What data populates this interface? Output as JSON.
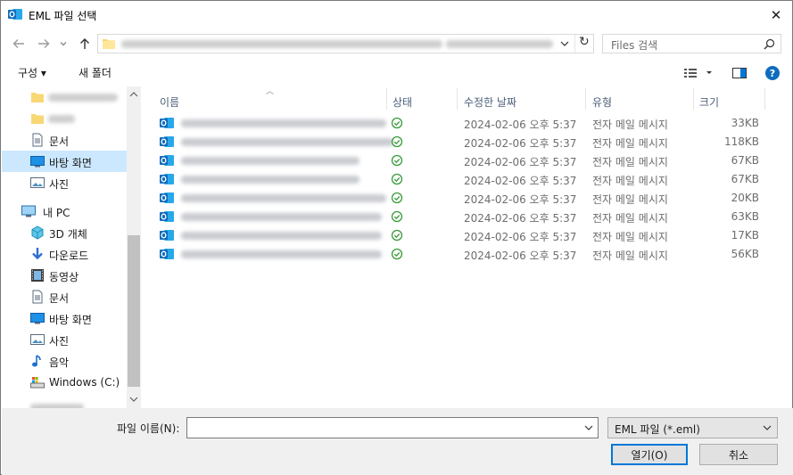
{
  "window": {
    "title": "EML 파일 선택",
    "close_glyph": "✕"
  },
  "address": {
    "refresh_glyph": "↻"
  },
  "search": {
    "placeholder": "Files 검색"
  },
  "toolbar": {
    "organize_label": "구성 ▾",
    "new_folder_label": "새 폴더",
    "help_glyph": "?"
  },
  "sidebar": {
    "items": [
      {
        "label": "문서",
        "icon": "document-icon"
      },
      {
        "label": "바탕 화면",
        "icon": "desktop-icon",
        "selected": true
      },
      {
        "label": "사진",
        "icon": "pictures-icon"
      },
      {
        "label": "내 PC",
        "icon": "pc-icon"
      },
      {
        "label": "3D 개체",
        "icon": "3d-objects-icon"
      },
      {
        "label": "다운로드",
        "icon": "download-icon"
      },
      {
        "label": "동영상",
        "icon": "video-icon"
      },
      {
        "label": "문서",
        "icon": "document-icon"
      },
      {
        "label": "바탕 화면",
        "icon": "desktop-icon"
      },
      {
        "label": "사진",
        "icon": "pictures-icon"
      },
      {
        "label": "음악",
        "icon": "music-icon"
      },
      {
        "label": "Windows (C:)",
        "icon": "drive-icon"
      }
    ]
  },
  "columns": {
    "name": "이름",
    "status": "상태",
    "modified": "수정한 날짜",
    "type": "유형",
    "size": "크기"
  },
  "files": [
    {
      "date": "2024-02-06 오후 5:37",
      "type": "전자 메일 메시지",
      "size": "33KB"
    },
    {
      "date": "2024-02-06 오후 5:37",
      "type": "전자 메일 메시지",
      "size": "118KB"
    },
    {
      "date": "2024-02-06 오후 5:37",
      "type": "전자 메일 메시지",
      "size": "67KB"
    },
    {
      "date": "2024-02-06 오후 5:37",
      "type": "전자 메일 메시지",
      "size": "67KB"
    },
    {
      "date": "2024-02-06 오후 5:37",
      "type": "전자 메일 메시지",
      "size": "20KB"
    },
    {
      "date": "2024-02-06 오후 5:37",
      "type": "전자 메일 메시지",
      "size": "63KB"
    },
    {
      "date": "2024-02-06 오후 5:37",
      "type": "전자 메일 메시지",
      "size": "17KB"
    },
    {
      "date": "2024-02-06 오후 5:37",
      "type": "전자 메일 메시지",
      "size": "56KB"
    }
  ],
  "footer": {
    "filename_label": "파일 이름(N):",
    "filename_value": "",
    "filetype_value": "EML 파일 (*.eml)",
    "open_label": "열기(O)",
    "cancel_label": "취소"
  },
  "colors": {
    "accent": "#0078d7",
    "selected_bg": "#cce8ff",
    "outlook_blue": "#0f6cbd",
    "status_green": "#3a9b3a"
  }
}
